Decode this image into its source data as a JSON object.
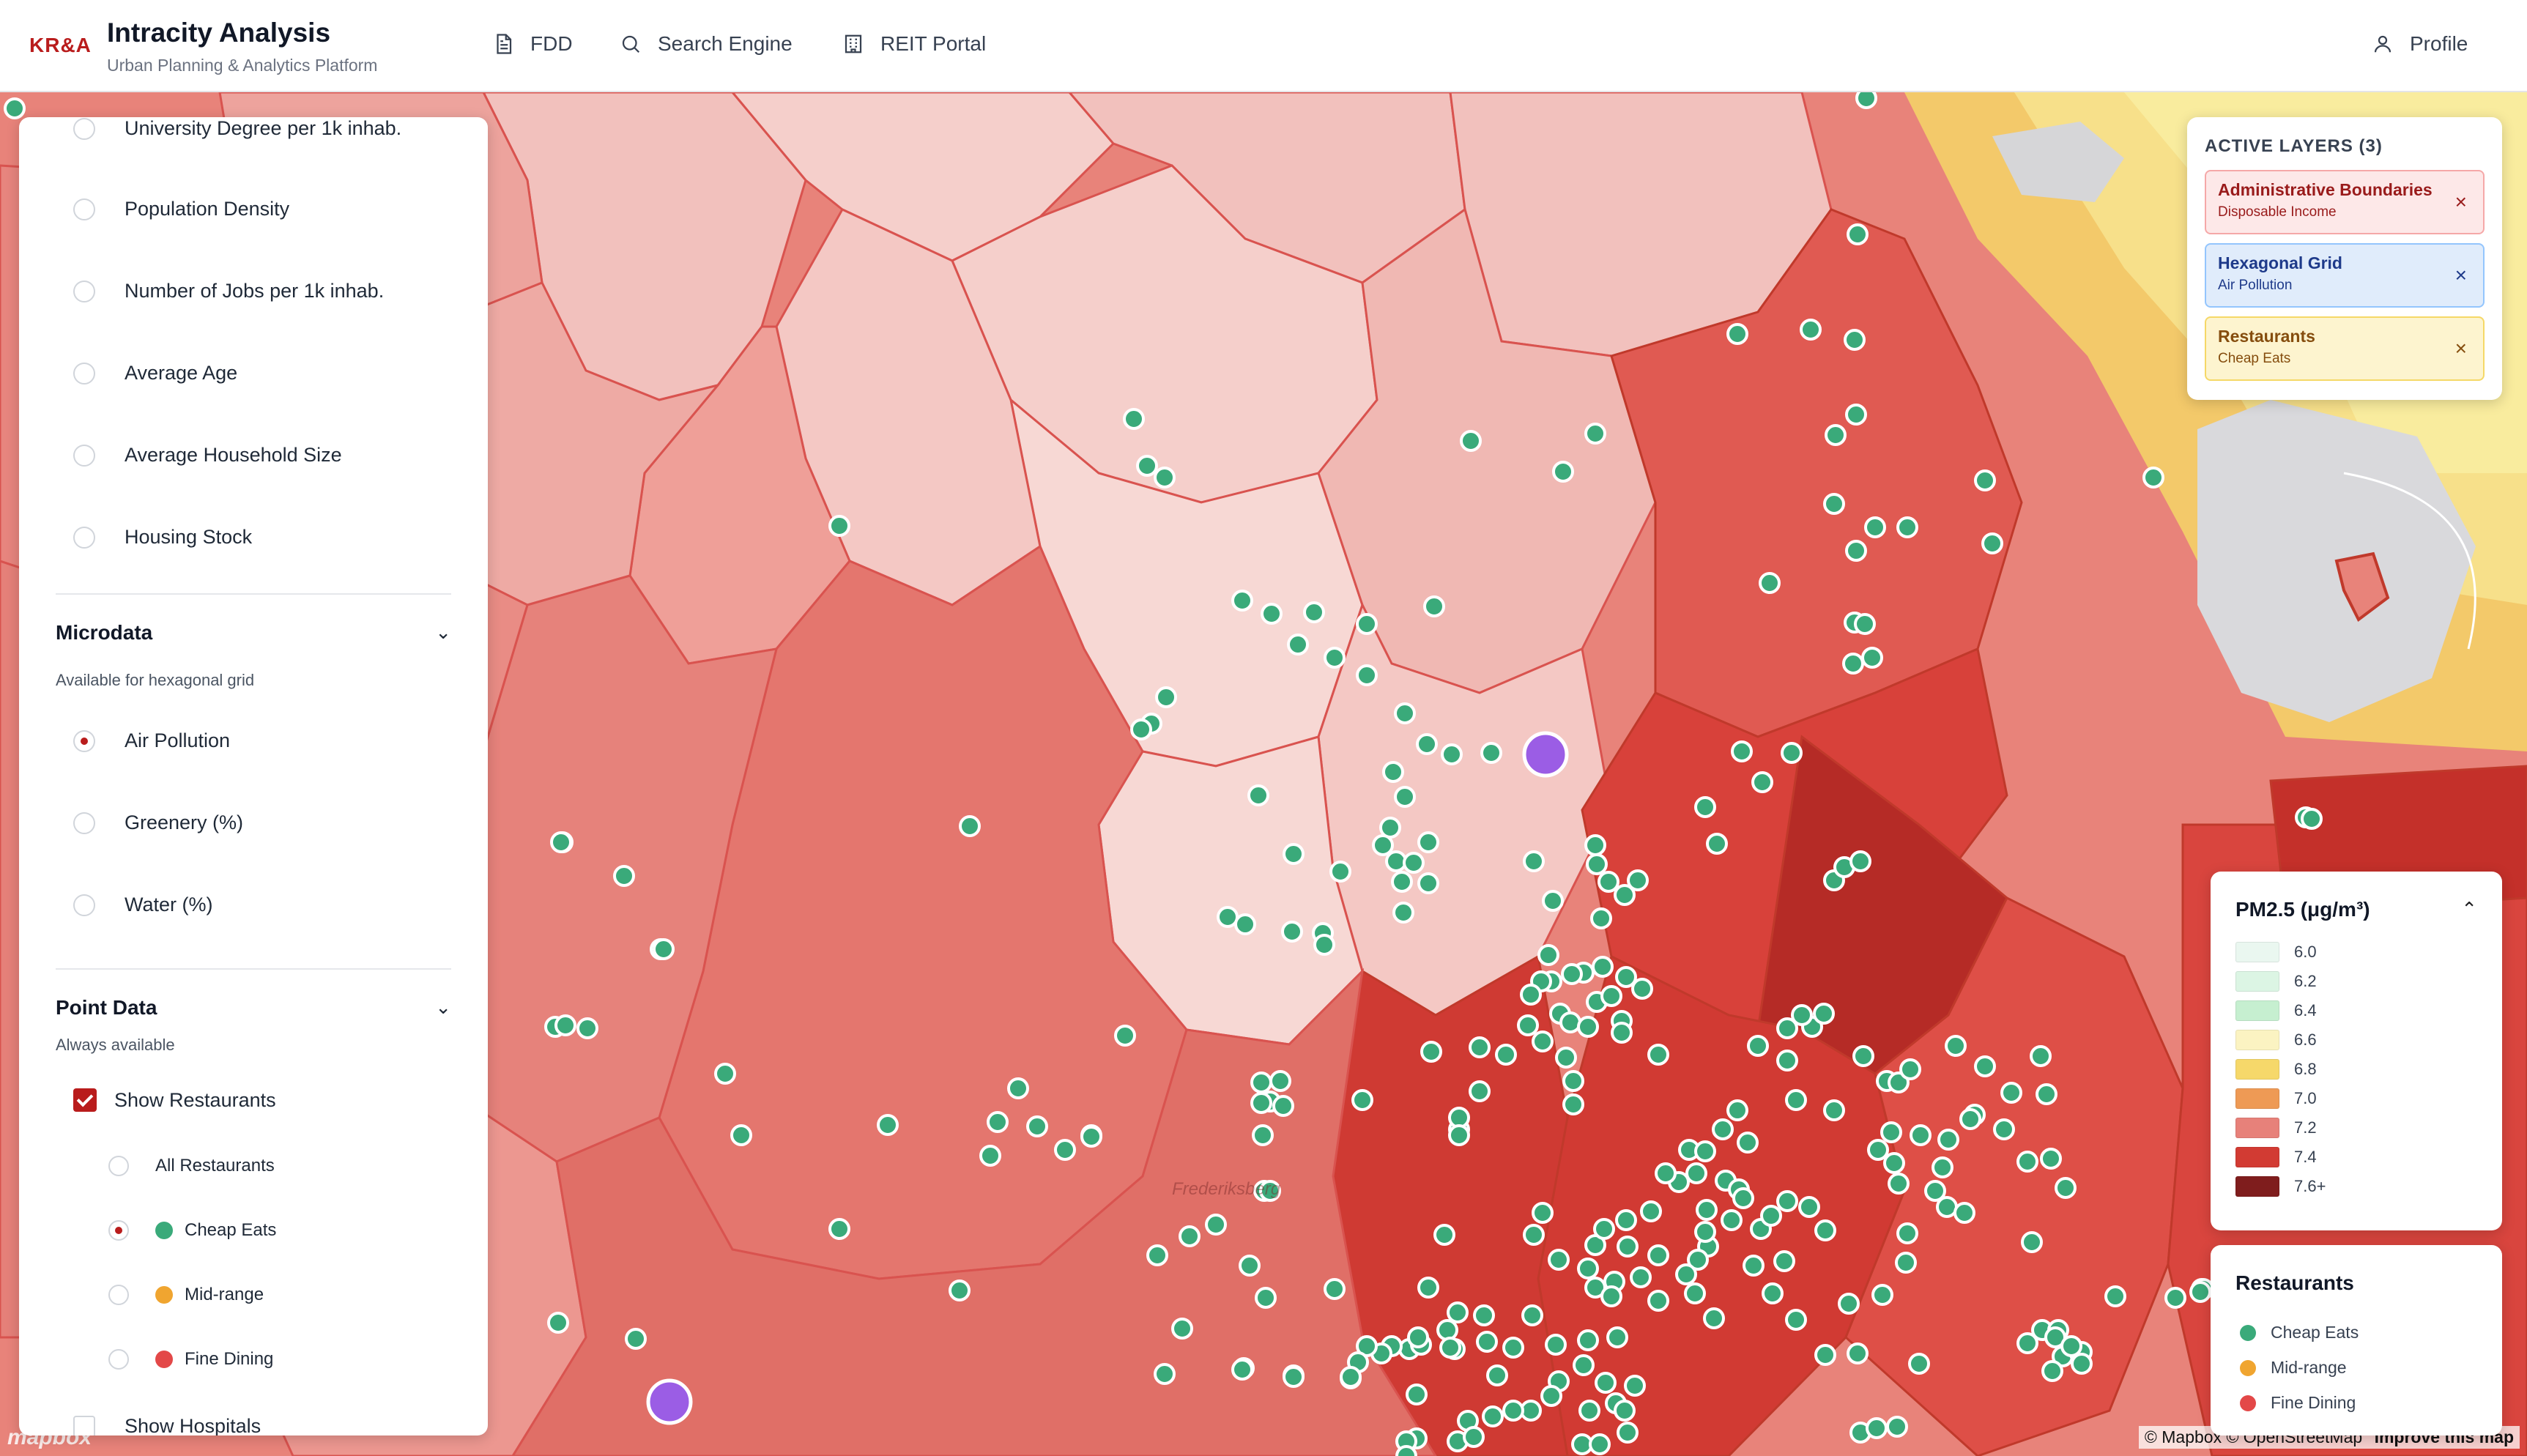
{
  "header": {
    "logo": "KR&A",
    "title": "Intracity Analysis",
    "subtitle": "Urban Planning & Analytics Platform",
    "nav": [
      {
        "label": "FDD",
        "icon": "document-icon"
      },
      {
        "label": "Search Engine",
        "icon": "search-icon"
      },
      {
        "label": "REIT Portal",
        "icon": "building-icon"
      }
    ],
    "profile": {
      "label": "Profile",
      "icon": "user-icon"
    }
  },
  "sidebar": {
    "census_items": [
      {
        "label": "University Degree per 1k inhab.",
        "checked": false
      },
      {
        "label": "Population Density",
        "checked": false
      },
      {
        "label": "Number of Jobs per 1k inhab.",
        "checked": false
      },
      {
        "label": "Average Age",
        "checked": false
      },
      {
        "label": "Average Household Size",
        "checked": false
      },
      {
        "label": "Housing Stock",
        "checked": false
      }
    ],
    "microdata": {
      "title": "Microdata",
      "subtitle": "Available for hexagonal grid",
      "items": [
        {
          "label": "Air Pollution",
          "checked": true
        },
        {
          "label": "Greenery (%)",
          "checked": false
        },
        {
          "label": "Water (%)",
          "checked": false
        }
      ]
    },
    "point_data": {
      "title": "Point Data",
      "subtitle": "Always available",
      "show_restaurants": "Show Restaurants",
      "restaurant_filters": [
        {
          "label": "All Restaurants",
          "checked": false,
          "color": ""
        },
        {
          "label": "Cheap Eats",
          "checked": true,
          "color": "#3aaa7a"
        },
        {
          "label": "Mid-range",
          "checked": false,
          "color": "#f0a530"
        },
        {
          "label": "Fine Dining",
          "checked": false,
          "color": "#e34848"
        }
      ],
      "show_hospitals": "Show Hospitals"
    }
  },
  "active_layers": {
    "title": "ACTIVE LAYERS (3)",
    "layers": [
      {
        "name": "Administrative Boundaries",
        "sub": "Disposable Income"
      },
      {
        "name": "Hexagonal Grid",
        "sub": "Air Pollution"
      },
      {
        "name": "Restaurants",
        "sub": "Cheap Eats"
      }
    ],
    "close_glyph": "×"
  },
  "pm_legend": {
    "title": "PM2.5 (μg/m³)",
    "entries": [
      {
        "label": "6.0",
        "color": "#eaf7f0"
      },
      {
        "label": "6.2",
        "color": "#dcf5e4"
      },
      {
        "label": "6.4",
        "color": "#c6efd0"
      },
      {
        "label": "6.6",
        "color": "#fbf3c2"
      },
      {
        "label": "6.8",
        "color": "#f6d86a"
      },
      {
        "label": "7.0",
        "color": "#ee9a55"
      },
      {
        "label": "7.2",
        "color": "#e7817a"
      },
      {
        "label": "7.4",
        "color": "#d23b33"
      },
      {
        "label": "7.6+",
        "color": "#7f1d1d"
      }
    ]
  },
  "restaurants_legend": {
    "title": "Restaurants",
    "entries": [
      {
        "label": "Cheap Eats",
        "color": "#3aaa7a"
      },
      {
        "label": "Mid-range",
        "color": "#f0a530"
      },
      {
        "label": "Fine Dining",
        "color": "#e34848"
      }
    ]
  },
  "map": {
    "attribution": "© Mapbox © OpenStreetMap",
    "improve": "Improve this map",
    "mapbox_mark": "mapbox",
    "place_label": "Frederiksberg"
  }
}
